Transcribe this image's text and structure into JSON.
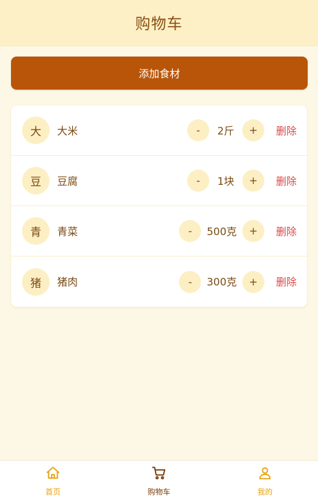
{
  "header": {
    "title": "购物车"
  },
  "actions": {
    "add_label": "添加食材"
  },
  "items": [
    {
      "avatar": "大",
      "name": "大米",
      "qty": "2斤",
      "minus": "-",
      "plus": "+",
      "delete": "删除"
    },
    {
      "avatar": "豆",
      "name": "豆腐",
      "qty": "1块",
      "minus": "-",
      "plus": "+",
      "delete": "删除"
    },
    {
      "avatar": "青",
      "name": "青菜",
      "qty": "500克",
      "minus": "-",
      "plus": "+",
      "delete": "删除"
    },
    {
      "avatar": "猪",
      "name": "猪肉",
      "qty": "300克",
      "minus": "-",
      "plus": "+",
      "delete": "删除"
    }
  ],
  "tabbar": {
    "tabs": [
      {
        "label": "首页",
        "icon": "home-icon",
        "active": false
      },
      {
        "label": "购物车",
        "icon": "cart-icon",
        "active": true
      },
      {
        "label": "我的",
        "icon": "user-icon",
        "active": false
      }
    ]
  },
  "colors": {
    "accent": "#b95509",
    "tab_inactive": "#e8a311",
    "tab_active": "#7a3c0a",
    "delete": "#d84a4a"
  }
}
